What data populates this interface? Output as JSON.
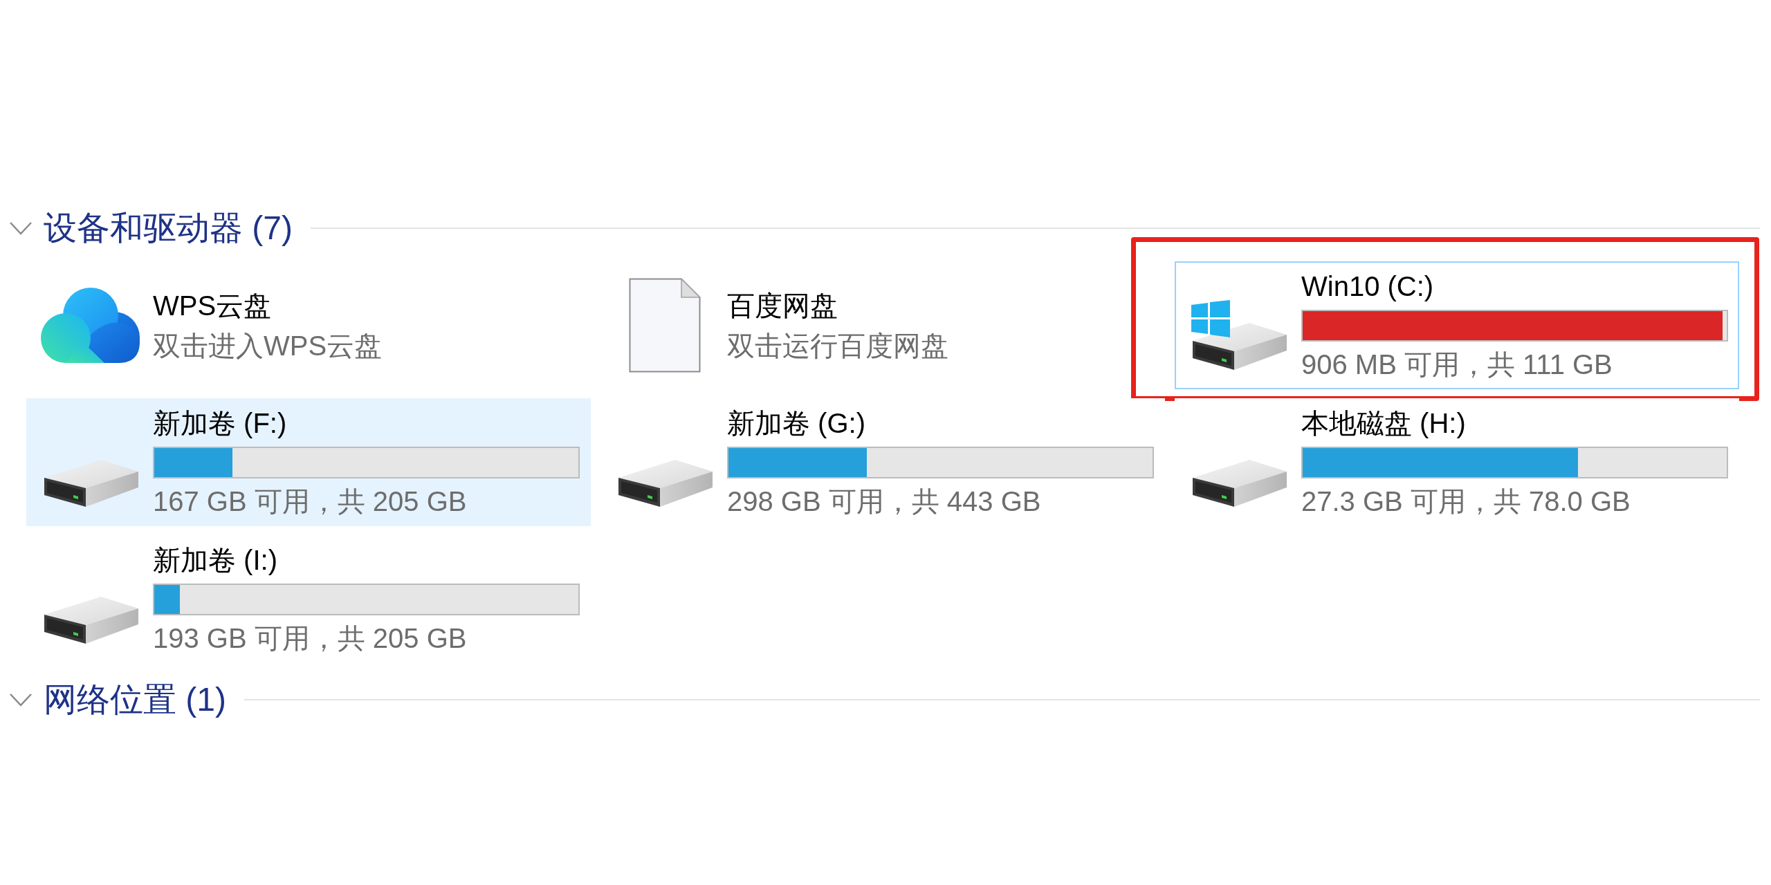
{
  "sections": [
    {
      "title": "设备和驱动器 (7)",
      "expanded": true,
      "items": [
        {
          "kind": "cloud",
          "name": "WPS云盘",
          "detail": "双击进入WPS云盘",
          "selected": false,
          "focused": false,
          "annotated": false
        },
        {
          "kind": "file",
          "name": "百度网盘",
          "detail": "双击运行百度网盘",
          "selected": false,
          "focused": false,
          "annotated": false
        },
        {
          "kind": "system_drive",
          "name": "Win10 (C:)",
          "level": 0.99,
          "color": "#da2626",
          "detail": "906 MB 可用，共 111 GB",
          "selected": false,
          "focused": true,
          "annotated": true
        },
        {
          "kind": "drive",
          "name": "新加卷 (F:)",
          "level": 0.185,
          "color": "#26a0da",
          "detail": "167 GB 可用，共 205 GB",
          "selected": true,
          "focused": false,
          "annotated": false
        },
        {
          "kind": "drive",
          "name": "新加卷 (G:)",
          "level": 0.327,
          "color": "#26a0da",
          "detail": "298 GB 可用，共 443 GB",
          "selected": false,
          "focused": false,
          "annotated": false
        },
        {
          "kind": "drive",
          "name": "本地磁盘 (H:)",
          "level": 0.65,
          "color": "#26a0da",
          "detail": "27.3 GB 可用，共 78.0 GB",
          "selected": false,
          "focused": false,
          "annotated": false
        },
        {
          "kind": "drive",
          "name": "新加卷 (I:)",
          "level": 0.06,
          "color": "#26a0da",
          "detail": "193 GB 可用，共 205 GB",
          "selected": false,
          "focused": false,
          "annotated": false
        }
      ]
    },
    {
      "title": "网络位置 (1)",
      "expanded": true
    }
  ]
}
